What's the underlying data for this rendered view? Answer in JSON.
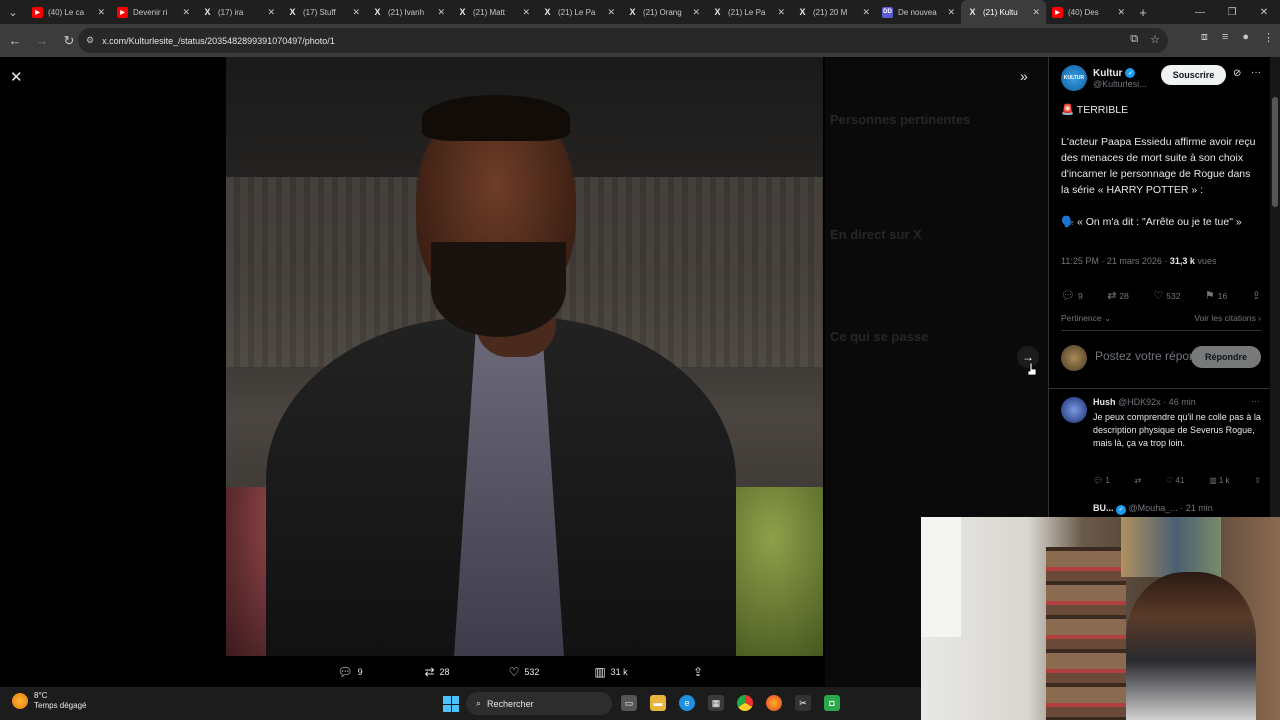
{
  "browser": {
    "tabs": [
      {
        "icon": "youtube-icon",
        "label": "(40) Le ca"
      },
      {
        "icon": "youtube-icon",
        "label": "Devenir ri"
      },
      {
        "icon": "x-icon",
        "label": "(17) ira"
      },
      {
        "icon": "x-icon",
        "label": "(17) Stuff"
      },
      {
        "icon": "x-icon",
        "label": "(21) Ivanh"
      },
      {
        "icon": "x-icon",
        "label": "(21) Matt"
      },
      {
        "icon": "x-icon",
        "label": "(21) Le Pa"
      },
      {
        "icon": "x-icon",
        "label": "(21) Orang"
      },
      {
        "icon": "x-icon",
        "label": "(21) Le Pa"
      },
      {
        "icon": "x-icon",
        "label": "(21) 20 M"
      },
      {
        "icon": "ai-icon",
        "label": "De nouvea"
      },
      {
        "icon": "x-icon",
        "label": "(21) Kultu",
        "active": true
      },
      {
        "icon": "youtube-icon",
        "label": "(40) Des"
      }
    ],
    "url": "x.com/Kulturlesite_/status/2035482899391070497/photo/1"
  },
  "viewer": {
    "stats": {
      "replies": "9",
      "reposts": "28",
      "likes": "532",
      "views": "31 k"
    }
  },
  "post": {
    "author_name": "Kultur",
    "author_handle": "@Kulturlesi...",
    "avatar_text": "KULTUR",
    "follow_label": "Souscrire",
    "line1": "🚨 TERRIBLE",
    "line2": "L'acteur Paapa Essiedu affirme avoir reçu des menaces de mort suite à son choix d'incarner le personnage de Rogue dans la série « HARRY POTTER » :",
    "line3": "🗣️ « On m'a dit : \"Arrête ou je te tue\" »",
    "timestamp": "11:25 PM · 21 mars 2026 ·",
    "views_count": "31,3 k",
    "views_label": "vues",
    "replies": "9",
    "reposts": "28",
    "likes": "532",
    "bookmarks": "16",
    "sort_label": "Pertinence",
    "quotes_label": "Voir les citations",
    "reply_placeholder": "Postez votre réponse",
    "reply_button": "Répondre"
  },
  "replies": [
    {
      "name": "Hush",
      "handle": "@HDK92x",
      "time": "· 46 min",
      "text": "Je peux comprendre qu'il ne colle pas à la description physique de Severus Rogue, mais là, ça va trop loin.",
      "replies": "1",
      "likes": "41",
      "views": "1 k"
    },
    {
      "name": "BU...",
      "handle": "@Mouha_...",
      "time": "· 21 min"
    }
  ],
  "background_panel": {
    "title": "Personnes pertinentes",
    "live_title": "En direct sur X",
    "happening_title": "Ce qui se passe"
  },
  "taskbar": {
    "temperature": "8°C",
    "weather": "Temps dégagé",
    "search_placeholder": "Rechercher"
  }
}
